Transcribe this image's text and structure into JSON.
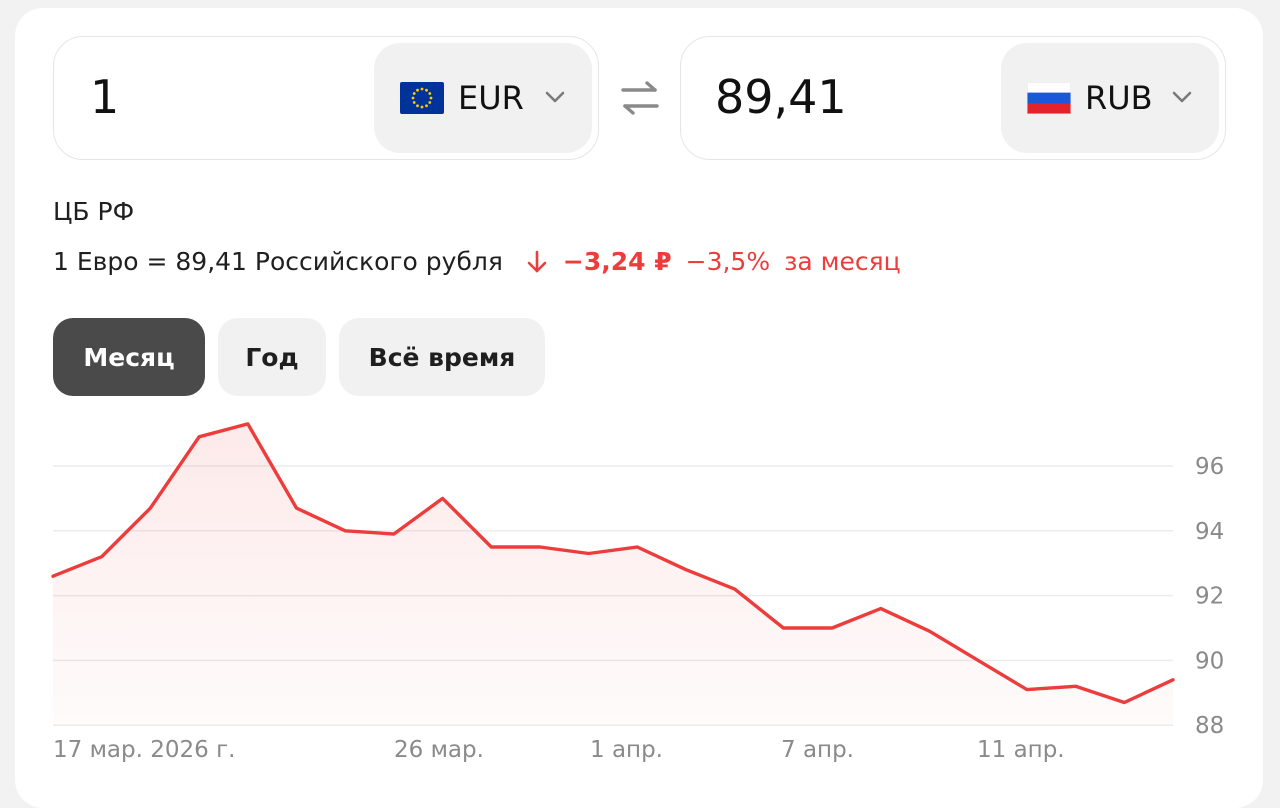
{
  "converter": {
    "from": {
      "amount": "1",
      "code": "EUR",
      "flag_icon": "eu-flag-icon"
    },
    "to": {
      "amount": "89,41",
      "code": "RUB",
      "flag_icon": "ru-flag-icon"
    },
    "swap_icon": "swap-arrows-icon"
  },
  "rate_info": {
    "source": "ЦБ РФ",
    "rate_text": "1 Евро = 89,41 Российского рубля",
    "change_abs": "−3,24 ₽",
    "change_pct": "−3,5%",
    "period_text": "за месяц",
    "down_color": "#ed3c3c"
  },
  "period_tabs": [
    {
      "label": "Месяц",
      "active": true
    },
    {
      "label": "Год",
      "active": false
    },
    {
      "label": "Всё время",
      "active": false
    }
  ],
  "chart_data": {
    "type": "area",
    "title": "",
    "xlabel": "",
    "ylabel": "",
    "x_tick_labels": [
      "17 мар. 2026 г.",
      "26 мар.",
      "1 апр.",
      "7 апр.",
      "11 апр."
    ],
    "y_tick_labels": [
      "96",
      "94",
      "92",
      "90",
      "88"
    ],
    "ylim": [
      88,
      97.3
    ],
    "grid": true,
    "line_color": "#ed3c3c",
    "series": [
      {
        "values": [
          92.6,
          93.2,
          94.7,
          96.9,
          97.3,
          94.7,
          94.0,
          93.9,
          95.0,
          93.5,
          93.5,
          93.3,
          93.5,
          92.8,
          92.2,
          91.0,
          91.0,
          91.6,
          90.9,
          90.0,
          89.1,
          89.2,
          88.7,
          89.4
        ]
      }
    ]
  }
}
